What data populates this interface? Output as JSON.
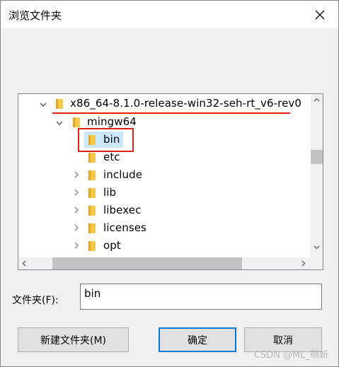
{
  "title": "浏览文件夹",
  "tree": {
    "root": "x86_64-8.1.0-release-win32-seh-rt_v6-rev0",
    "child": "mingw64",
    "items": [
      "bin",
      "etc",
      "include",
      "lib",
      "libexec",
      "licenses",
      "opt"
    ]
  },
  "folder_field": {
    "label": "文件夹(F):",
    "value": "bin"
  },
  "buttons": {
    "new_folder": "新建文件夹(M)",
    "ok": "确定",
    "cancel": "取消"
  },
  "colors": {
    "selection": "#cce8ff",
    "highlight": "#e0201b",
    "folder": "#f7c746",
    "default_button_border": "#0078d7"
  },
  "watermark": "CSDN @ML_萌新"
}
